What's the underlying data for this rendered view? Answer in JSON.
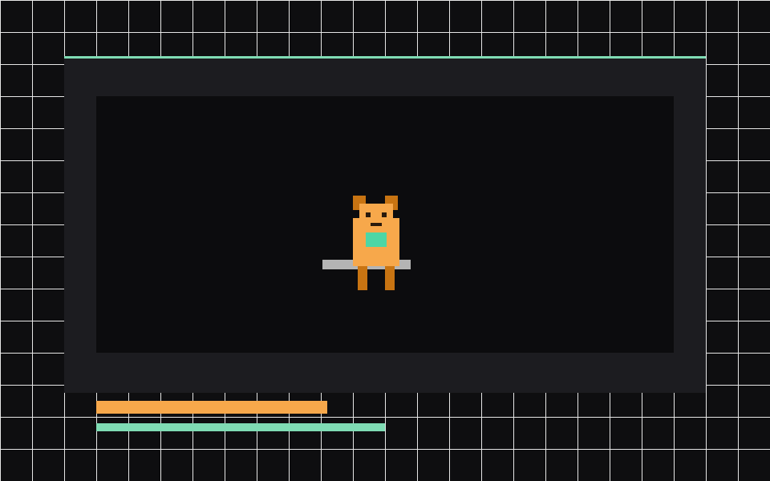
{
  "colors": {
    "background": "#0e0e10",
    "grid_line": "#e6e6e6",
    "frame": "#1c1c20",
    "arena": "#0c0c0e",
    "accent_mint": "#7fdcb4",
    "character_body": "#f7a84b",
    "character_dark": "#c87412",
    "character_eye": "#2a1a0c",
    "character_chest": "#4dd6a5",
    "platform": "#b4b4b4"
  },
  "character": {
    "name": "orange-bear-sprite",
    "icon": "bear-icon"
  },
  "platform": {
    "icon": "platform-bar"
  },
  "bars": {
    "health_fraction": 0.8,
    "energy_fraction": 1.0
  }
}
